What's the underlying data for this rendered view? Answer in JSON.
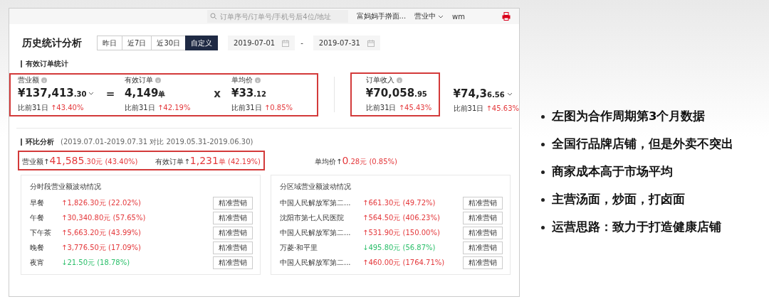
{
  "header": {
    "search": {
      "placeholder": "订单序号/订单号/手机号后4位/地址"
    },
    "store": "富妈妈手擀面...",
    "status": "营业中",
    "account": "wm"
  },
  "title": "历史统计分析",
  "ranges": [
    {
      "label": "昨日",
      "selected": false
    },
    {
      "label": "近7日",
      "selected": false
    },
    {
      "label": "近30日",
      "selected": false
    },
    {
      "label": "自定义",
      "selected": true
    }
  ],
  "date_from": "2019-07-01",
  "date_sep": "-",
  "date_to": "2019-07-31",
  "summary": {
    "title": "有效订单统计",
    "groups": [
      {
        "highlighted": true,
        "items": [
          {
            "label": "营业额",
            "value": "¥137,413",
            "decimal": ".30",
            "dropdown": true,
            "compare": "比前31日",
            "change": "↑43.40%"
          },
          {
            "kind": "operator",
            "symbol": "="
          },
          {
            "label": "有效订单",
            "value": "4,149",
            "decimal": "单",
            "compare": "比前31日",
            "change": "↑42.19%"
          },
          {
            "kind": "operator",
            "symbol": "x"
          },
          {
            "label": "单均价",
            "value": "¥33",
            "decimal": ".12",
            "compare": "比前31日",
            "change": "↑0.85%"
          }
        ]
      },
      {
        "highlighted": true,
        "items": [
          {
            "label": "订单收入",
            "value": "¥70,058",
            "decimal": ".95",
            "compare": "比前31日",
            "change": "↑45.43%"
          }
        ]
      },
      {
        "highlighted": false,
        "items": [
          {
            "value": "¥74,3",
            "decimal": "6.56",
            "dropdown": true,
            "compare": "比前31日",
            "change": "↑45.63%"
          }
        ]
      }
    ]
  },
  "comparison": {
    "title": "环比分析",
    "period": "(2019.07.01-2019.07.31 对比 2019.05.31-2019.06.30)",
    "groups": [
      {
        "highlighted": true,
        "items": [
          {
            "label": "营业额",
            "arrow": "↑",
            "value": "41,585",
            "unit": ".30元",
            "percent": "(43.40%)"
          },
          {
            "label": "有效订单",
            "arrow": "↑",
            "value": "1,231",
            "unit": "单",
            "percent": "(42.19%)"
          }
        ]
      },
      {
        "highlighted": false,
        "items": [
          {
            "label": "单均价",
            "arrow": "↑",
            "value": "0",
            "unit": ".28元",
            "percent": "(0.85%)"
          }
        ]
      }
    ]
  },
  "panels": [
    {
      "title": "分时段营业额波动情况",
      "rows": [
        {
          "name": "早餐",
          "color": "#e4393c",
          "change": "↑1,826.30元 (22.02%)",
          "button": "精准营销"
        },
        {
          "name": "午餐",
          "color": "#e4393c",
          "change": "↑30,340.80元 (57.65%)",
          "button": "精准营销"
        },
        {
          "name": "下午茶",
          "color": "#e4393c",
          "change": "↑5,663.20元 (43.99%)",
          "button": "精准营销"
        },
        {
          "name": "晚餐",
          "color": "#e4393c",
          "change": "↑3,776.50元 (17.09%)",
          "button": "精准营销"
        },
        {
          "name": "夜宵",
          "color": "#2bbf6a",
          "change": "↓21.50元 (18.78%)",
          "button": "精准营销"
        }
      ]
    },
    {
      "title": "分区域营业额波动情况",
      "rows": [
        {
          "name": "中国人民解放军第二...",
          "color": "#e4393c",
          "change": "↑661.30元 (49.72%)",
          "button": "精准营销"
        },
        {
          "name": "沈阳市第七人民医院",
          "color": "#e4393c",
          "change": "↑564.50元 (406.23%)",
          "button": "精准营销"
        },
        {
          "name": "中国人民解放军第二...",
          "color": "#e4393c",
          "change": "↑531.90元 (150.00%)",
          "button": "精准营销"
        },
        {
          "name": "万菱·和平里",
          "color": "#2bbf6a",
          "change": "↓495.80元 (56.87%)",
          "button": "精准营销"
        },
        {
          "name": "中国人民解放军第二...",
          "color": "#e4393c",
          "change": "↑460.00元 (1764.71%)",
          "button": "精准营销"
        }
      ]
    }
  ],
  "bullets": [
    "左图为合作周期第3个月数据",
    "全国行品牌店铺，但是外卖不突出",
    "商家成本高于市场平均",
    "主营汤面，炒面，打卤面",
    "运营思路：致力于打造健康店铺"
  ]
}
